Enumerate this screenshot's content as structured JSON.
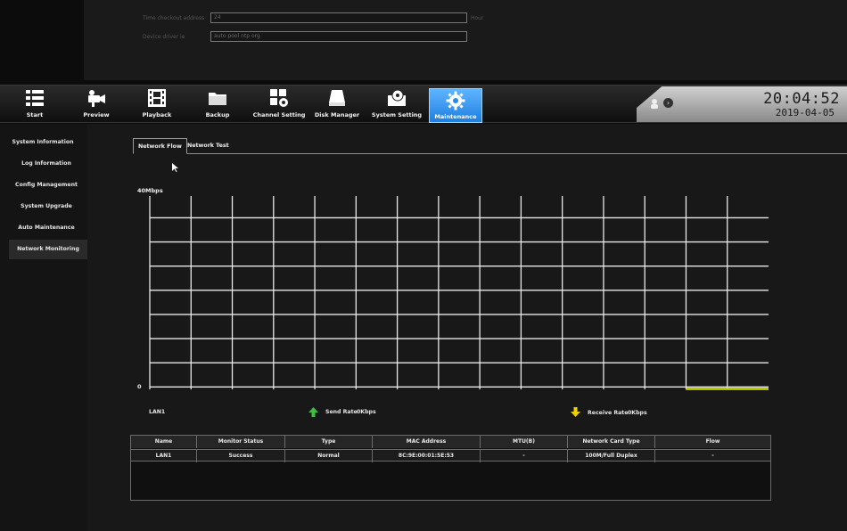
{
  "background_dialog": {
    "row1_label": "Time checkout address",
    "row1_value": "24",
    "row1_unit": "Hour",
    "row2_label": "Device driver ie",
    "row2_value": "auto pool ntp org"
  },
  "menu": [
    {
      "label": "Start",
      "icon": "list-icon"
    },
    {
      "label": "Preview",
      "icon": "camera-icon"
    },
    {
      "label": "Playback",
      "icon": "film-icon"
    },
    {
      "label": "Backup",
      "icon": "folder-icon"
    },
    {
      "label": "Channel Setting",
      "icon": "channel-gear-icon"
    },
    {
      "label": "Disk Manager",
      "icon": "disk-icon"
    },
    {
      "label": "System Setting",
      "icon": "system-gear-icon"
    },
    {
      "label": "Maintenance",
      "icon": "gear-icon"
    }
  ],
  "clock": {
    "time": "20:04:52",
    "date": "2019-04-05"
  },
  "sidebar": {
    "items": [
      {
        "label": "System Information"
      },
      {
        "label": "Log Information"
      },
      {
        "label": "Config Management"
      },
      {
        "label": "System Upgrade"
      },
      {
        "label": "Auto Maintenance"
      },
      {
        "label": "Network Monitoring"
      }
    ]
  },
  "tabs": [
    {
      "label": "Network Flow"
    },
    {
      "label": "Network Test"
    }
  ],
  "chart": {
    "y_max_label": "40Mbps",
    "y_min_label": "0",
    "series_color": "#c8e000",
    "send_color": "#3fbf3f",
    "receive_color": "#f0d000"
  },
  "chart_data": {
    "type": "line",
    "ylim_label": [
      "0",
      "40Mbps"
    ],
    "series": [
      {
        "values": [
          0,
          0
        ]
      }
    ],
    "grid": true
  },
  "legend": {
    "interface": "LAN1",
    "send_label": "Send Rate",
    "send_value": "0Kbps",
    "receive_label": "Receive Rate",
    "receive_value": "0Kbps"
  },
  "table": {
    "headers": [
      "Name",
      "Monitor Status",
      "Type",
      "MAC Address",
      "MTU(B)",
      "Network Card Type",
      "Flow"
    ],
    "rows": [
      [
        "LAN1",
        "Success",
        "Normal",
        "8C:9E:00:01:5E:53",
        "-",
        "100M/Full Duplex",
        "-"
      ]
    ]
  }
}
